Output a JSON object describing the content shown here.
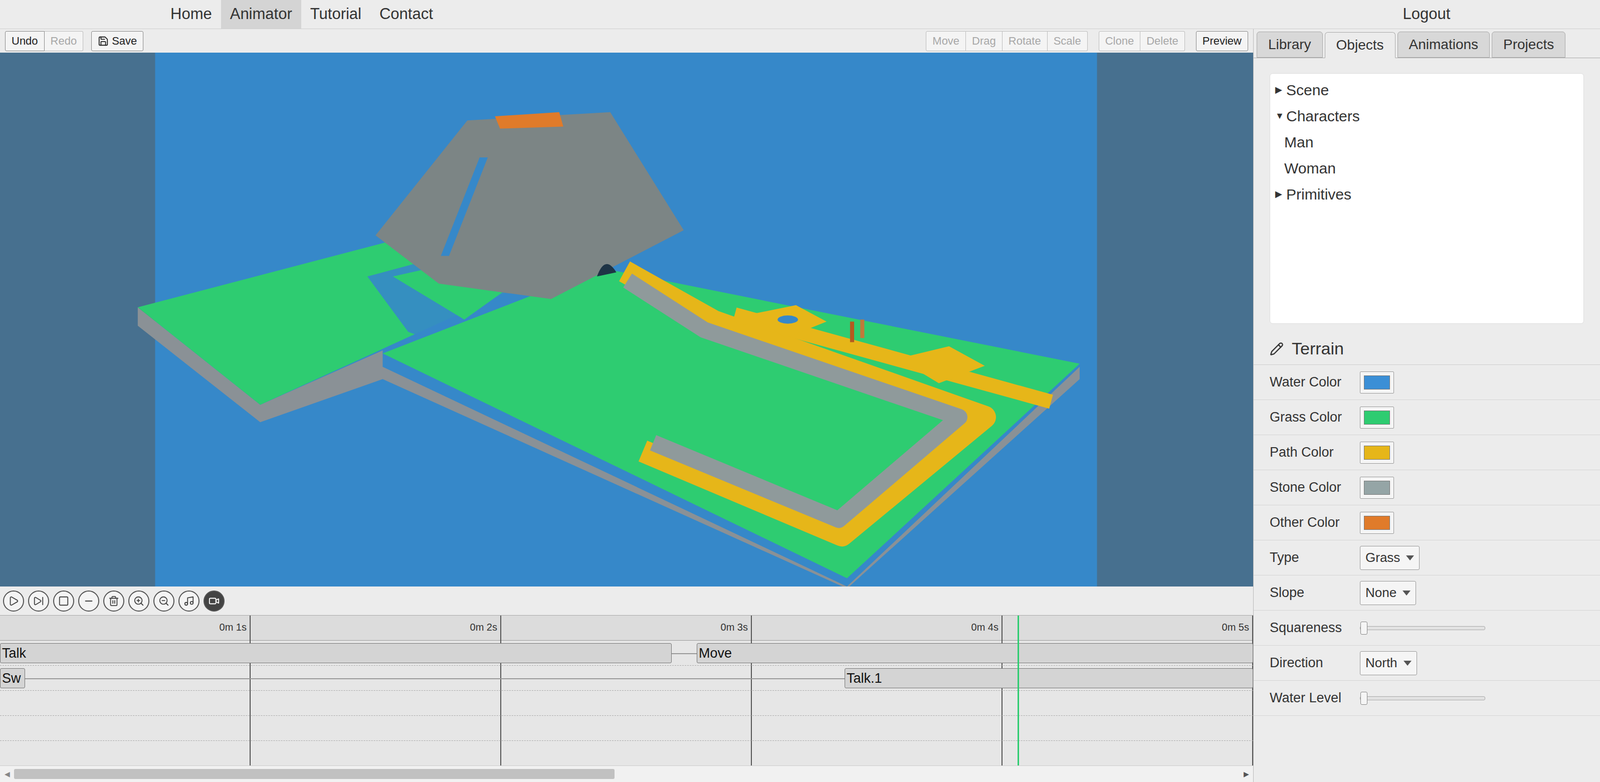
{
  "nav": {
    "items": [
      {
        "label": "Home",
        "selected": false
      },
      {
        "label": "Animator",
        "selected": true
      },
      {
        "label": "Tutorial",
        "selected": false
      },
      {
        "label": "Contact",
        "selected": false
      }
    ],
    "logout": "Logout"
  },
  "toolbar": {
    "left": [
      [
        {
          "label": "Undo",
          "disabled": false,
          "kind": "text"
        },
        {
          "label": "Redo",
          "disabled": true,
          "kind": "text"
        }
      ],
      [
        {
          "label": "Save",
          "disabled": false,
          "kind": "save"
        }
      ]
    ],
    "right": [
      [
        {
          "label": "Move",
          "disabled": true,
          "kind": "text"
        },
        {
          "label": "Drag",
          "disabled": true,
          "kind": "text"
        },
        {
          "label": "Rotate",
          "disabled": true,
          "kind": "text"
        },
        {
          "label": "Scale",
          "disabled": true,
          "kind": "text"
        }
      ],
      [
        {
          "label": "Clone",
          "disabled": true,
          "kind": "text"
        },
        {
          "label": "Delete",
          "disabled": true,
          "kind": "text"
        }
      ],
      [
        {
          "label": "Preview",
          "disabled": false,
          "kind": "text"
        }
      ]
    ]
  },
  "playback": {
    "camera_active": true
  },
  "timeline": {
    "visible_seconds": 5,
    "ticks": [
      {
        "label": "0m 1s",
        "time": 1
      },
      {
        "label": "0m 2s",
        "time": 2
      },
      {
        "label": "0m 3s",
        "time": 3
      },
      {
        "label": "0m 4s",
        "time": 4
      },
      {
        "label": "0m 5s",
        "time": 5
      }
    ],
    "tracks": [
      {
        "clips": [
          {
            "label": "Talk",
            "start": 0,
            "end": 2.68
          },
          {
            "label": "Move",
            "start": 2.78,
            "end": 5
          }
        ]
      },
      {
        "clips": [
          {
            "label": "Sw",
            "start": 0,
            "end": 0.1
          },
          {
            "label": "Talk.1",
            "start": 3.37,
            "end": 5
          }
        ]
      },
      {
        "clips": []
      },
      {
        "clips": []
      },
      {
        "clips": []
      }
    ],
    "playhead": 4.06
  },
  "scrollbar": {
    "left": "◀",
    "right": "▶",
    "level": 0.49
  },
  "panel": {
    "tabs": [
      {
        "label": "Library",
        "selected": false
      },
      {
        "label": "Objects",
        "selected": true
      },
      {
        "label": "Animations",
        "selected": false
      },
      {
        "label": "Projects",
        "selected": false
      }
    ],
    "tree": [
      {
        "label": "Scene",
        "arrow": "▶",
        "expanded": false,
        "children": []
      },
      {
        "label": "Characters",
        "arrow": "▼",
        "expanded": true,
        "children": [
          "Man",
          "Woman"
        ]
      },
      {
        "label": "Primitives",
        "arrow": "▶",
        "expanded": false,
        "children": []
      }
    ],
    "section": {
      "title": "Terrain"
    },
    "properties": [
      {
        "label": "Water Color",
        "kind": "color",
        "color": "#3b8fd6"
      },
      {
        "label": "Grass Color",
        "kind": "color",
        "color": "#2ecc71"
      },
      {
        "label": "Path Color",
        "kind": "color",
        "color": "#e6b619"
      },
      {
        "label": "Stone Color",
        "kind": "color",
        "color": "#95a5a6"
      },
      {
        "label": "Other Color",
        "kind": "color",
        "color": "#e07b2a"
      },
      {
        "label": "Type",
        "kind": "select",
        "value": "Grass"
      },
      {
        "label": "Slope",
        "kind": "select",
        "value": "None"
      },
      {
        "label": "Squareness",
        "kind": "slider",
        "level": 0
      },
      {
        "label": "Direction",
        "kind": "select",
        "value": "North"
      },
      {
        "label": "Water Level",
        "kind": "slider",
        "level": 0
      }
    ]
  }
}
